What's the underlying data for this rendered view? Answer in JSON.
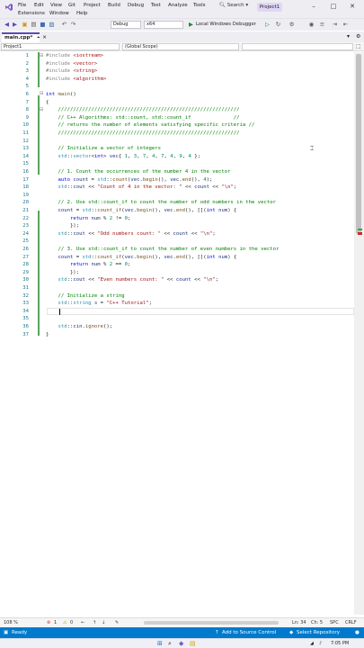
{
  "menu": {
    "items": [
      "File",
      "Edit",
      "View",
      "Git",
      "Project",
      "Build",
      "Debug",
      "Test",
      "Analyze",
      "Tools"
    ],
    "items_row2": [
      "Extensions",
      "Window",
      "Help"
    ],
    "search_label": "Search",
    "project_name": "Project1"
  },
  "toolbar": {
    "config": "Debug",
    "platform": "x64",
    "debugger_label": "Local Windows Debugger"
  },
  "tabs": {
    "active_label": "main.cpp*"
  },
  "navbar": {
    "project": "Project1",
    "scope": "(Global Scope)"
  },
  "editor": {
    "line_numbers": [
      "1",
      "2",
      "3",
      "4",
      "5",
      "6",
      "7",
      "8",
      "9",
      "10",
      "11",
      "12",
      "13",
      "14",
      "15",
      "16",
      "17",
      "18",
      "19",
      "20",
      "21",
      "22",
      "23",
      "24",
      "25",
      "26",
      "27",
      "28",
      "29",
      "30",
      "31",
      "32",
      "33",
      "34",
      "35",
      "36",
      "37"
    ]
  },
  "infobar": {
    "zoom": "108 %",
    "errors": "1",
    "warnings": "0",
    "line": "Ln: 34",
    "col": "Ch: 5",
    "spacing": "SPC",
    "eol": "CRLF"
  },
  "statusbar": {
    "ready": "Ready",
    "source_control": "Add to Source Control",
    "repository": "Select Repository"
  },
  "taskbar": {
    "time": "7:05 PM"
  },
  "colors": {
    "accent": "#5f4bb6",
    "status_blue": "#007acc"
  }
}
